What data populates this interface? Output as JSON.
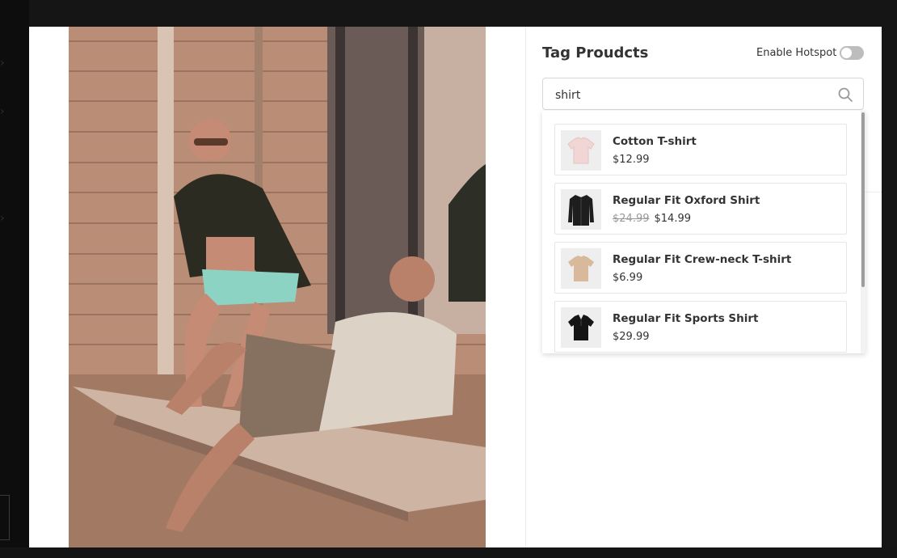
{
  "panel": {
    "title": "Tag Proudcts",
    "hotspot_label": "Enable Hotspot",
    "hotspot_enabled": false
  },
  "search": {
    "value": "shirt",
    "icon": "search-icon"
  },
  "products": [
    {
      "name": "Cotton T-shirt",
      "price": "$12.99",
      "old_price": "",
      "thumb_color": "#f2d6d6",
      "icon": "tshirt-icon"
    },
    {
      "name": "Regular Fit Oxford Shirt",
      "price": "$14.99",
      "old_price": "$24.99",
      "thumb_color": "#1e1e1e",
      "icon": "shirt-icon"
    },
    {
      "name": "Regular Fit Crew-neck T-shirt",
      "price": "$6.99",
      "old_price": "",
      "thumb_color": "#d8b99b",
      "icon": "tshirt-icon"
    },
    {
      "name": "Regular Fit Sports Shirt",
      "price": "$29.99",
      "old_price": "",
      "thumb_color": "#151515",
      "icon": "polo-icon"
    }
  ],
  "colors": {
    "toggle_off": "#bdbdbd",
    "modal_bg": "#ffffff"
  }
}
